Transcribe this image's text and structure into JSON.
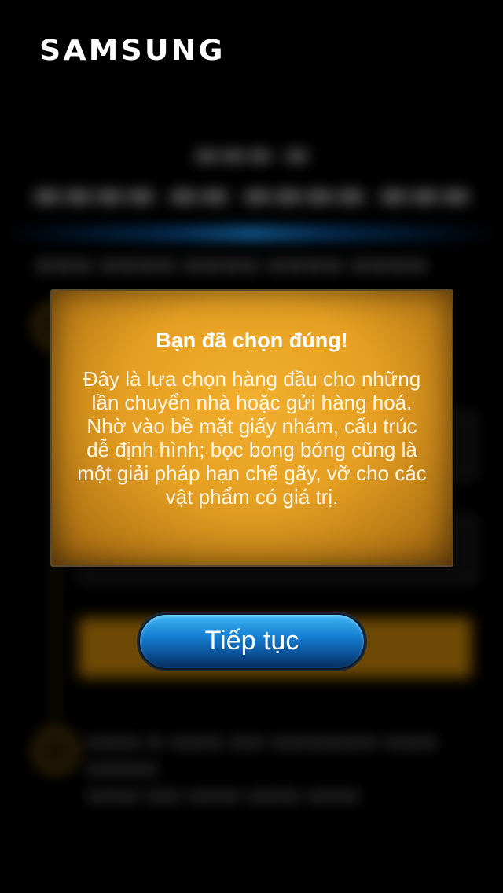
{
  "brand": {
    "name": "SAMSUNG"
  },
  "dialog": {
    "title": "Bạn đã chọn đúng!",
    "message": "Đây là lựa chọn hàng đầu cho những lần chuyển nhà hoặc gửi hàng hoá. Nhờ vào bề mặt giấy nhám, cấu trúc dễ định hình; bọc bong bóng cũng là một giải pháp hạn chế gãy, vỡ cho các vật phẩm có giá trị."
  },
  "actions": {
    "continue_label": "Tiếp tục"
  },
  "colors": {
    "dialog_accent": "#e59f22",
    "button_accent": "#1680d2",
    "background": "#000000"
  }
}
